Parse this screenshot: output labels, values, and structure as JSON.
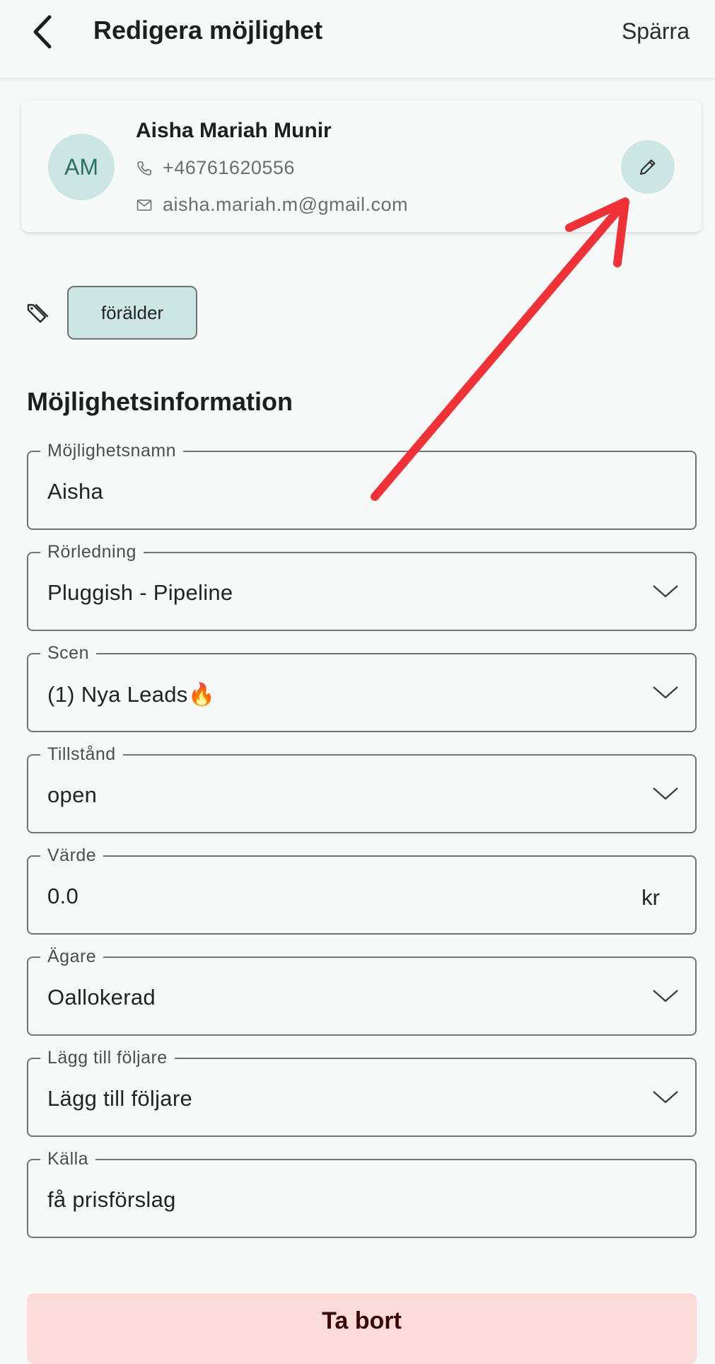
{
  "appbar": {
    "title": "Redigera möjlighet",
    "save_label": "Spärra",
    "back_icon": "chevron-left-icon"
  },
  "contact": {
    "initials": "AM",
    "name": "Aisha Mariah Munir",
    "phone": "+46761620556",
    "email": "aisha.mariah.m@gmail.com",
    "phone_icon": "phone-icon",
    "email_icon": "mail-icon",
    "edit_icon": "pencil-icon"
  },
  "tags": {
    "icon": "tag-icon",
    "items": [
      "förälder"
    ]
  },
  "section": {
    "heading": "Möjlighetsinformation"
  },
  "fields": {
    "name": {
      "label": "Möjlighetsnamn",
      "value": "Aisha"
    },
    "pipeline": {
      "label": "Rörledning",
      "value": "Pluggish - Pipeline"
    },
    "stage": {
      "label": "Scen",
      "value": "(1) Nya Leads🔥"
    },
    "status": {
      "label": "Tillstånd",
      "value": "open"
    },
    "value": {
      "label": "Värde",
      "value": "0.0",
      "suffix": "kr"
    },
    "owner": {
      "label": "Ägare",
      "value": "Oallokerad"
    },
    "followers": {
      "label": "Lägg till följare",
      "value": "Lägg till följare"
    },
    "source": {
      "label": "Källa",
      "value": "få prisförslag"
    }
  },
  "actions": {
    "delete_label": "Ta bort"
  },
  "colors": {
    "background": "#f6f9f7",
    "accent_teal": "#cde6e4",
    "avatar_text": "#2b6f69",
    "delete_bg": "#fcdcd9",
    "delete_text": "#3a0906",
    "annotation_arrow": "#ee3237"
  }
}
